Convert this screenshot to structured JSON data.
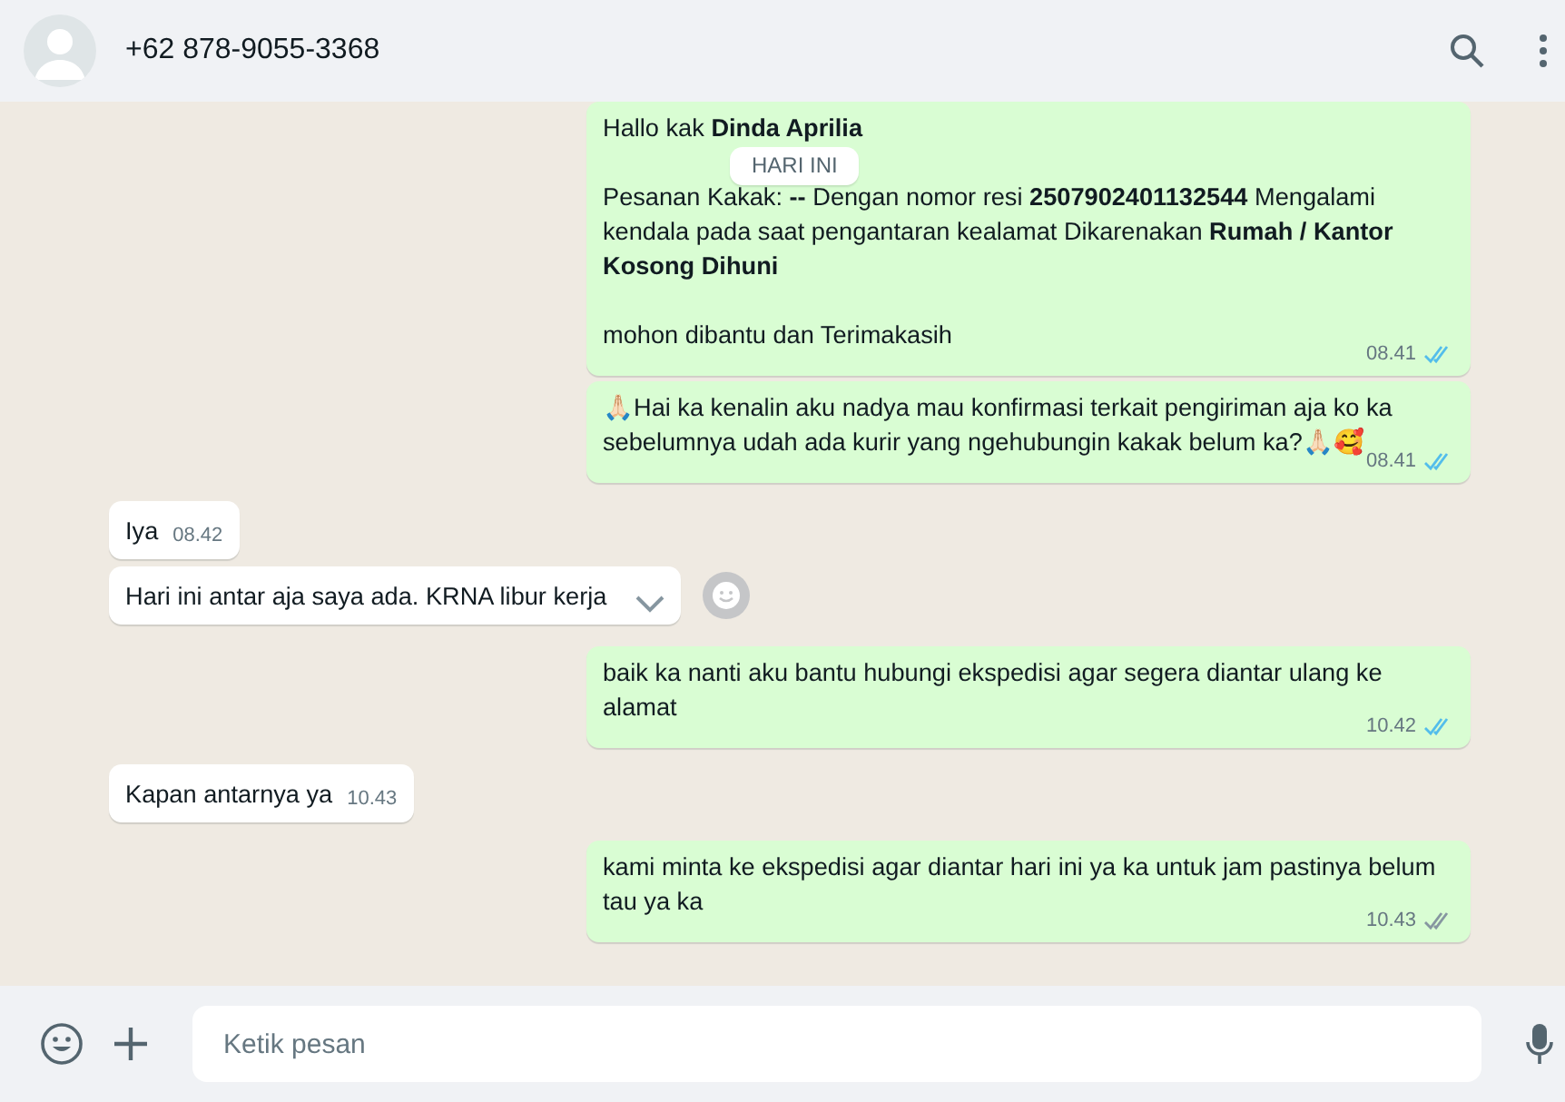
{
  "header": {
    "contact": "+62 878-9055-3368"
  },
  "date_badge": "HARI INI",
  "messages": [
    {
      "kind": "outgoing",
      "paragraphs": [
        "Hallo kak **Dinda Aprilia**",
        "Pesanan Kakak: **--** Dengan nomor resi **2507902401132544** Mengalami kendala pada saat pengantaran kealamat Dikarenakan **Rumah / Kantor Kosong Dihuni**",
        " mohon dibantu dan Terimakasih"
      ],
      "time": "08.41",
      "read": true
    },
    {
      "kind": "outgoing",
      "paragraphs": [
        "🙏🏻Hai ka kenalin aku nadya mau konfirmasi terkait pengiriman aja ko ka sebelumnya udah ada kurir yang ngehubungin kakak belum ka?🙏🏻🥰"
      ],
      "time": "08.41",
      "read": true
    },
    {
      "kind": "incoming",
      "paragraphs": [
        "Iya"
      ],
      "time": "08.42"
    },
    {
      "kind": "incoming",
      "paragraphs": [
        "Hari ini antar aja saya ada. KRNA libur kerja"
      ],
      "hovered": true
    },
    {
      "kind": "outgoing",
      "paragraphs": [
        "baik ka nanti aku bantu hubungi ekspedisi agar segera diantar ulang ke alamat"
      ],
      "time": "10.42",
      "read": true
    },
    {
      "kind": "incoming",
      "paragraphs": [
        "Kapan antarnya ya"
      ],
      "time": "10.43"
    },
    {
      "kind": "outgoing",
      "paragraphs": [
        "kami minta ke ekspedisi agar diantar hari ini ya ka untuk jam pastinya belum tau ya ka"
      ],
      "time": "10.43",
      "read": false
    }
  ],
  "composer": {
    "placeholder": "Ketik pesan"
  }
}
